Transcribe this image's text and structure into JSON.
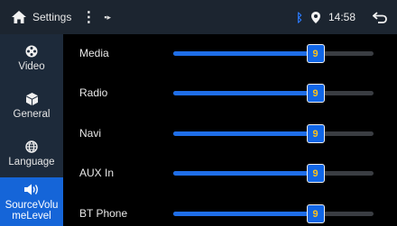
{
  "statusbar": {
    "title": "Settings",
    "menu_glyph": "⋮",
    "usb_glyph": "▪▸",
    "bt_glyph": "ᛒ",
    "time": "14:58"
  },
  "sidebar": {
    "items": [
      {
        "label": "Video",
        "icon": "film-reel-icon",
        "active": false
      },
      {
        "label": "General",
        "icon": "cube-icon",
        "active": false
      },
      {
        "label": "Language",
        "icon": "globe-icon",
        "active": false
      },
      {
        "label": "SourceVolumeLevel",
        "line1": "SourceVolu",
        "line2": "meLevel",
        "icon": "speaker-icon",
        "active": true
      }
    ]
  },
  "sources": [
    {
      "label": "Media",
      "value": "9",
      "level": 0.71
    },
    {
      "label": "Radio",
      "value": "9",
      "level": 0.71
    },
    {
      "label": "Navi",
      "value": "9",
      "level": 0.71
    },
    {
      "label": "AUX In",
      "value": "9",
      "level": 0.71
    },
    {
      "label": "BT Phone",
      "value": "9",
      "level": 0.71
    }
  ],
  "colors": {
    "accent": "#1565d8",
    "thumb_text": "#ffc21a",
    "sidebar_bg": "#1d2a3a",
    "statusbar_bg": "#1c2530",
    "bluetooth": "#2b7bff"
  }
}
